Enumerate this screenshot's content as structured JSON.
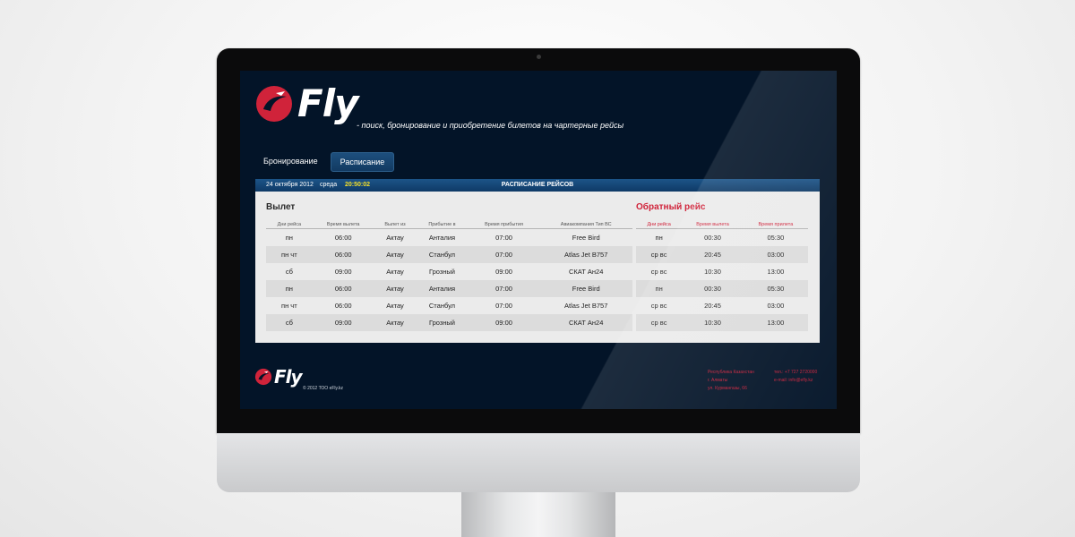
{
  "brand": {
    "name": "Fly",
    "tagline": "- поиск, бронирование и приобретение билетов на чартерные рейсы"
  },
  "nav": [
    {
      "label": "Бронирование"
    },
    {
      "label": "Расписание"
    }
  ],
  "schedule_bar": {
    "date": "24 октября 2012",
    "day": "среда",
    "time": "20:50:02",
    "title": "РАСПИСАНИЕ РЕЙСОВ"
  },
  "departure": {
    "title": "Вылет",
    "headers": [
      "Дни рейса",
      "Время вылета",
      "Вылет из",
      "Прибытие в",
      "Время прибытия",
      "Авиакомпания Тип ВС"
    ],
    "rows": [
      [
        "пн",
        "06:00",
        "Актау",
        "Анталия",
        "07:00",
        "Free Bird"
      ],
      [
        "пн чт",
        "06:00",
        "Актау",
        "Станбул",
        "07:00",
        "Atlas Jet B757"
      ],
      [
        "сб",
        "09:00",
        "Актау",
        "Грозный",
        "09:00",
        "СКАТ Ан24"
      ],
      [
        "пн",
        "06:00",
        "Актау",
        "Анталия",
        "07:00",
        "Free Bird"
      ],
      [
        "пн чт",
        "06:00",
        "Актау",
        "Станбул",
        "07:00",
        "Atlas Jet B757"
      ],
      [
        "сб",
        "09:00",
        "Актау",
        "Грозный",
        "09:00",
        "СКАТ Ан24"
      ]
    ]
  },
  "return_flight": {
    "title": "Обратный рейс",
    "headers": [
      "Дни рейса",
      "Время вылета",
      "Время прилета"
    ],
    "rows": [
      [
        "пн",
        "00:30",
        "05:30"
      ],
      [
        "ср вс",
        "20:45",
        "03:00"
      ],
      [
        "ср вс",
        "10:30",
        "13:00"
      ],
      [
        "пн",
        "00:30",
        "05:30"
      ],
      [
        "ср вс",
        "20:45",
        "03:00"
      ],
      [
        "ср вс",
        "10:30",
        "13:00"
      ]
    ]
  },
  "footer": {
    "copyright": "© 2012 ТОО eFly.kz",
    "address": [
      "Республика Казахстан",
      "г. Алматы",
      "ул. Курмангазы, 66"
    ],
    "phone": "тел.: +7 727 2720000",
    "email": "e-mail: info@efly.kz"
  },
  "colors": {
    "accent": "#d0233a",
    "screen_bg": "#031428",
    "time": "#f5e028"
  }
}
